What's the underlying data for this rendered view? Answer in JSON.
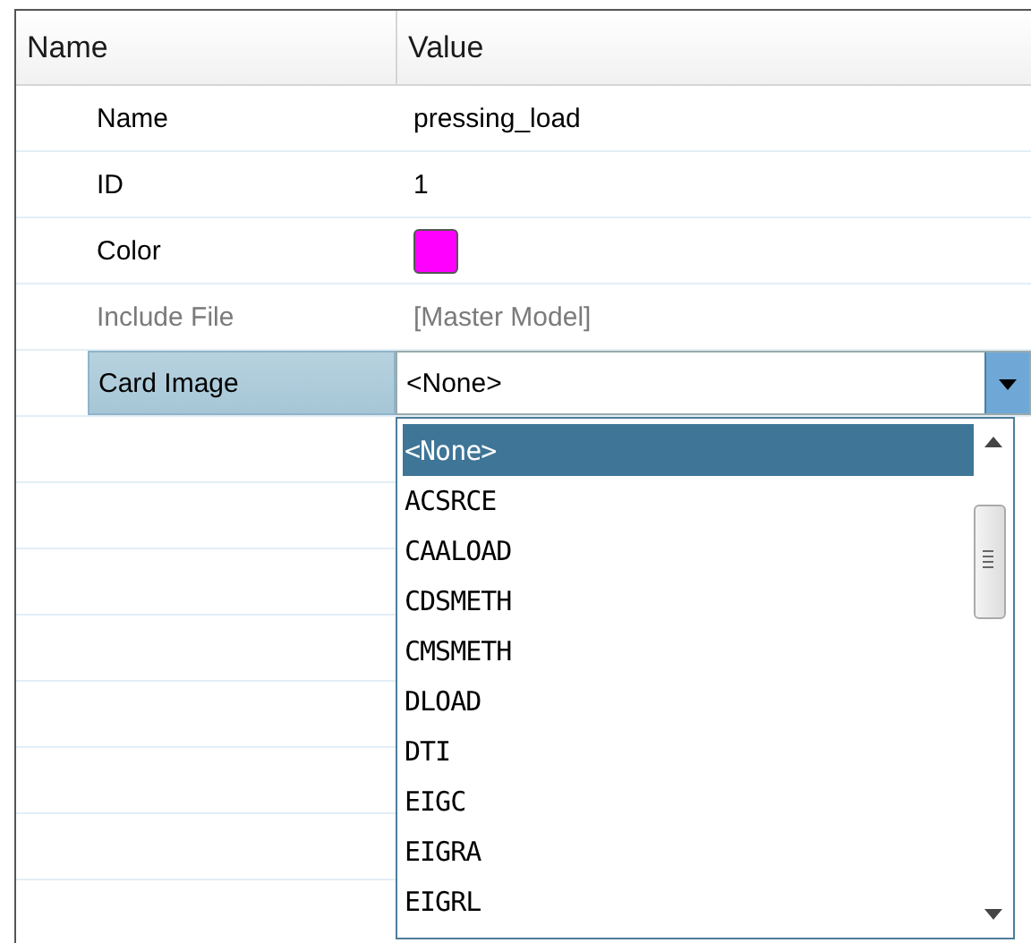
{
  "columns": [
    "Name",
    "Value"
  ],
  "rows": [
    {
      "kind": "text",
      "name": "Name",
      "value": "pressing_load",
      "disabled": false,
      "selected": false
    },
    {
      "kind": "text",
      "name": "ID",
      "value": "1",
      "disabled": false,
      "selected": false
    },
    {
      "kind": "color",
      "name": "Color",
      "color": "#ff00ff",
      "disabled": false,
      "selected": false
    },
    {
      "kind": "text",
      "name": "Include File",
      "value": "[Master Model]",
      "disabled": true,
      "selected": false
    },
    {
      "kind": "dropdown",
      "name": "Card Image",
      "value": "<None>",
      "disabled": false,
      "selected": true,
      "expanded": true,
      "options": [
        {
          "label": "<None>",
          "selected": true
        },
        {
          "label": "ACSRCE",
          "selected": false
        },
        {
          "label": "CAALOAD",
          "selected": false
        },
        {
          "label": "CDSMETH",
          "selected": false
        },
        {
          "label": "CMSMETH",
          "selected": false
        },
        {
          "label": "DLOAD",
          "selected": false
        },
        {
          "label": "DTI",
          "selected": false
        },
        {
          "label": "EIGC",
          "selected": false
        },
        {
          "label": "EIGRA",
          "selected": false
        },
        {
          "label": "EIGRL",
          "selected": false
        }
      ]
    }
  ]
}
